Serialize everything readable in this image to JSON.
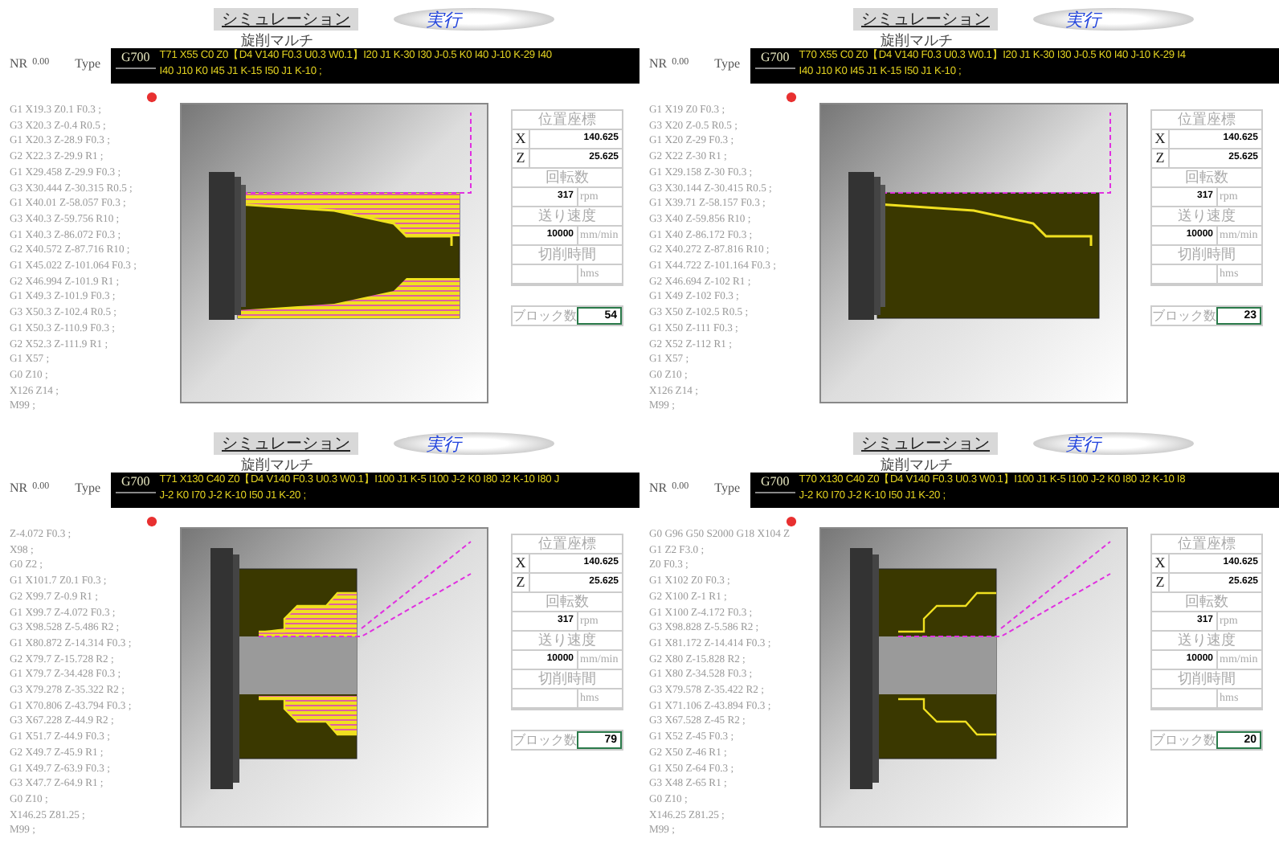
{
  "panels": [
    {
      "title": "シミュレーション",
      "run_button": "実行",
      "subtitle": "旋削マルチ",
      "nr_label": "NR",
      "nr_value": "0.00",
      "type_label": "Type",
      "type_code": "G700",
      "type_lines": [
        "T71 X55 C0 Z0【D4 V140 F0.3 U0.3 W0.1】I20 J1 K-30 I30 J-0.5 K0 I40 J-10 K-29 I40",
        "I40 J10 K0 I45 J1 K-15 I50 J1 K-10 ;"
      ],
      "program": [
        "G1 X19.3 Z0.1 F0.3 ;",
        "G3 X20.3 Z-0.4 R0.5 ;",
        "G1 X20.3 Z-28.9 F0.3 ;",
        "G2 X22.3 Z-29.9 R1 ;",
        "G1 X29.458 Z-29.9 F0.3 ;",
        "G3 X30.444 Z-30.315 R0.5 ;",
        "G1 X40.01 Z-58.057 F0.3 ;",
        "G3 X40.3 Z-59.756 R10 ;",
        "G1 X40.3 Z-86.072 F0.3 ;",
        "G2 X40.572 Z-87.716 R10 ;",
        "G1 X45.022 Z-101.064 F0.3 ;",
        "G2 X46.994 Z-101.9 R1 ;",
        "G1 X49.3 Z-101.9 F0.3 ;",
        "G3 X50.3 Z-102.4 R0.5 ;",
        "G1 X50.3 Z-110.9 F0.3 ;",
        "G2 X52.3 Z-111.9 R1 ;",
        "G1 X57 ;",
        "G0 Z10 ;",
        "X126 Z14 ;",
        "M99 ;"
      ],
      "drawing": {
        "kind": "outer",
        "hatched": true
      },
      "position": {
        "heading": "位置座標",
        "rows": [
          {
            "axis": "X",
            "value": "140.625"
          },
          {
            "axis": "Z",
            "value": "25.625"
          }
        ]
      },
      "readouts": [
        {
          "heading": "回転数",
          "value": "317",
          "unit": "rpm"
        },
        {
          "heading": "送り速度",
          "value": "10000",
          "unit": "mm/min"
        },
        {
          "heading": "切削時間",
          "unit": "hms"
        }
      ],
      "block_label": "ブロック数",
      "block_count": "54"
    },
    {
      "title": "シミュレーション",
      "run_button": "実行",
      "subtitle": "旋削マルチ",
      "nr_label": "NR",
      "nr_value": "0.00",
      "type_label": "Type",
      "type_code": "G700",
      "type_lines": [
        "T70 X55 C0 Z0【D4 V140 F0.3 U0.3 W0.1】I20 J1 K-30 I30 J-0.5 K0 I40 J-10 K-29 I4",
        "I40 J10 K0 I45 J1 K-15 I50 J1 K-10 ;"
      ],
      "program": [
        "G1 X19 Z0 F0.3 ;",
        "G3 X20 Z-0.5 R0.5 ;",
        "G1 X20 Z-29 F0.3 ;",
        "G2 X22 Z-30 R1 ;",
        "G1 X29.158 Z-30 F0.3 ;",
        "G3 X30.144 Z-30.415 R0.5 ;",
        "G1 X39.71 Z-58.157 F0.3 ;",
        "G3 X40 Z-59.856 R10 ;",
        "G1 X40 Z-86.172 F0.3 ;",
        "G2 X40.272 Z-87.816 R10 ;",
        "G1 X44.722 Z-101.164 F0.3 ;",
        "G2 X46.694 Z-102 R1 ;",
        "G1 X49 Z-102 F0.3 ;",
        "G3 X50 Z-102.5 R0.5 ;",
        "G1 X50 Z-111 F0.3 ;",
        "G2 X52 Z-112 R1 ;",
        "G1 X57 ;",
        "G0 Z10 ;",
        "X126 Z14 ;",
        "M99 ;"
      ],
      "drawing": {
        "kind": "outer",
        "hatched": false
      },
      "position": {
        "heading": "位置座標",
        "rows": [
          {
            "axis": "X",
            "value": "140.625"
          },
          {
            "axis": "Z",
            "value": "25.625"
          }
        ]
      },
      "readouts": [
        {
          "heading": "回転数",
          "value": "317",
          "unit": "rpm"
        },
        {
          "heading": "送り速度",
          "value": "10000",
          "unit": "mm/min"
        },
        {
          "heading": "切削時間",
          "unit": "hms"
        }
      ],
      "block_label": "ブロック数",
      "block_count": "23"
    },
    {
      "title": "シミュレーション",
      "run_button": "実行",
      "subtitle": "旋削マルチ",
      "nr_label": "NR",
      "nr_value": "0.00",
      "type_label": "Type",
      "type_code": "G700",
      "type_lines": [
        "T71 X130 C40 Z0【D4 V140 F0.3 U0.3 W0.1】I100 J1 K-5 I100 J-2 K0 I80 J2 K-10 I80 J",
        "J-2 K0 I70 J-2 K-10 I50 J1 K-20 ;"
      ],
      "program": [
        "Z-4.072 F0.3 ;",
        "X98 ;",
        "G0 Z2 ;",
        "G1 X101.7 Z0.1 F0.3 ;",
        "G2 X99.7 Z-0.9 R1 ;",
        "G1 X99.7 Z-4.072 F0.3 ;",
        "G3 X98.528 Z-5.486 R2 ;",
        "G1 X80.872 Z-14.314 F0.3 ;",
        "G2 X79.7 Z-15.728 R2 ;",
        "G1 X79.7 Z-34.428 F0.3 ;",
        "G3 X79.278 Z-35.322 R2 ;",
        "G1 X70.806 Z-43.794 F0.3 ;",
        "G3 X67.228 Z-44.9 R2 ;",
        "G1 X51.7 Z-44.9 F0.3 ;",
        "G2 X49.7 Z-45.9 R1 ;",
        "G1 X49.7 Z-63.9 F0.3 ;",
        "G3 X47.7 Z-64.9 R1 ;",
        "G0 Z10 ;",
        "X146.25 Z81.25 ;",
        "M99 ;"
      ],
      "drawing": {
        "kind": "inner",
        "hatched": true
      },
      "position": {
        "heading": "位置座標",
        "rows": [
          {
            "axis": "X",
            "value": "140.625"
          },
          {
            "axis": "Z",
            "value": "25.625"
          }
        ]
      },
      "readouts": [
        {
          "heading": "回転数",
          "value": "317",
          "unit": "rpm"
        },
        {
          "heading": "送り速度",
          "value": "10000",
          "unit": "mm/min"
        },
        {
          "heading": "切削時間",
          "unit": "hms"
        }
      ],
      "block_label": "ブロック数",
      "block_count": "79"
    },
    {
      "title": "シミュレーション",
      "run_button": "実行",
      "subtitle": "旋削マルチ",
      "nr_label": "NR",
      "nr_value": "0.00",
      "type_label": "Type",
      "type_code": "G700",
      "type_lines": [
        "T70 X130 C40 Z0【D4 V140 F0.3 U0.3 W0.1】I100 J1 K-5 I100 J-2 K0 I80 J2 K-10 I8",
        "J-2 K0 I70 J-2 K-10 I50 J1 K-20 ;"
      ],
      "program": [
        "G0 G96 G50 S2000 G18 X104 Z",
        "G1 Z2 F3.0 ;",
        "Z0 F0.3 ;",
        "G1 X102 Z0 F0.3 ;",
        "G2 X100 Z-1 R1 ;",
        "G1 X100 Z-4.172 F0.3 ;",
        "G3 X98.828 Z-5.586 R2 ;",
        "G1 X81.172 Z-14.414 F0.3 ;",
        "G2 X80 Z-15.828 R2 ;",
        "G1 X80 Z-34.528 F0.3 ;",
        "G3 X79.578 Z-35.422 R2 ;",
        "G1 X71.106 Z-43.894 F0.3 ;",
        "G3 X67.528 Z-45 R2 ;",
        "G1 X52 Z-45 F0.3 ;",
        "G2 X50 Z-46 R1 ;",
        "G1 X50 Z-64 F0.3 ;",
        "G3 X48 Z-65 R1 ;",
        "G0 Z10 ;",
        "X146.25 Z81.25 ;",
        "M99 ;"
      ],
      "drawing": {
        "kind": "inner",
        "hatched": false
      },
      "position": {
        "heading": "位置座標",
        "rows": [
          {
            "axis": "X",
            "value": "140.625"
          },
          {
            "axis": "Z",
            "value": "25.625"
          }
        ]
      },
      "readouts": [
        {
          "heading": "回転数",
          "value": "317",
          "unit": "rpm"
        },
        {
          "heading": "送り速度",
          "value": "10000",
          "unit": "mm/min"
        },
        {
          "heading": "切削時間",
          "unit": "hms"
        }
      ],
      "block_label": "ブロック数",
      "block_count": "20"
    }
  ]
}
